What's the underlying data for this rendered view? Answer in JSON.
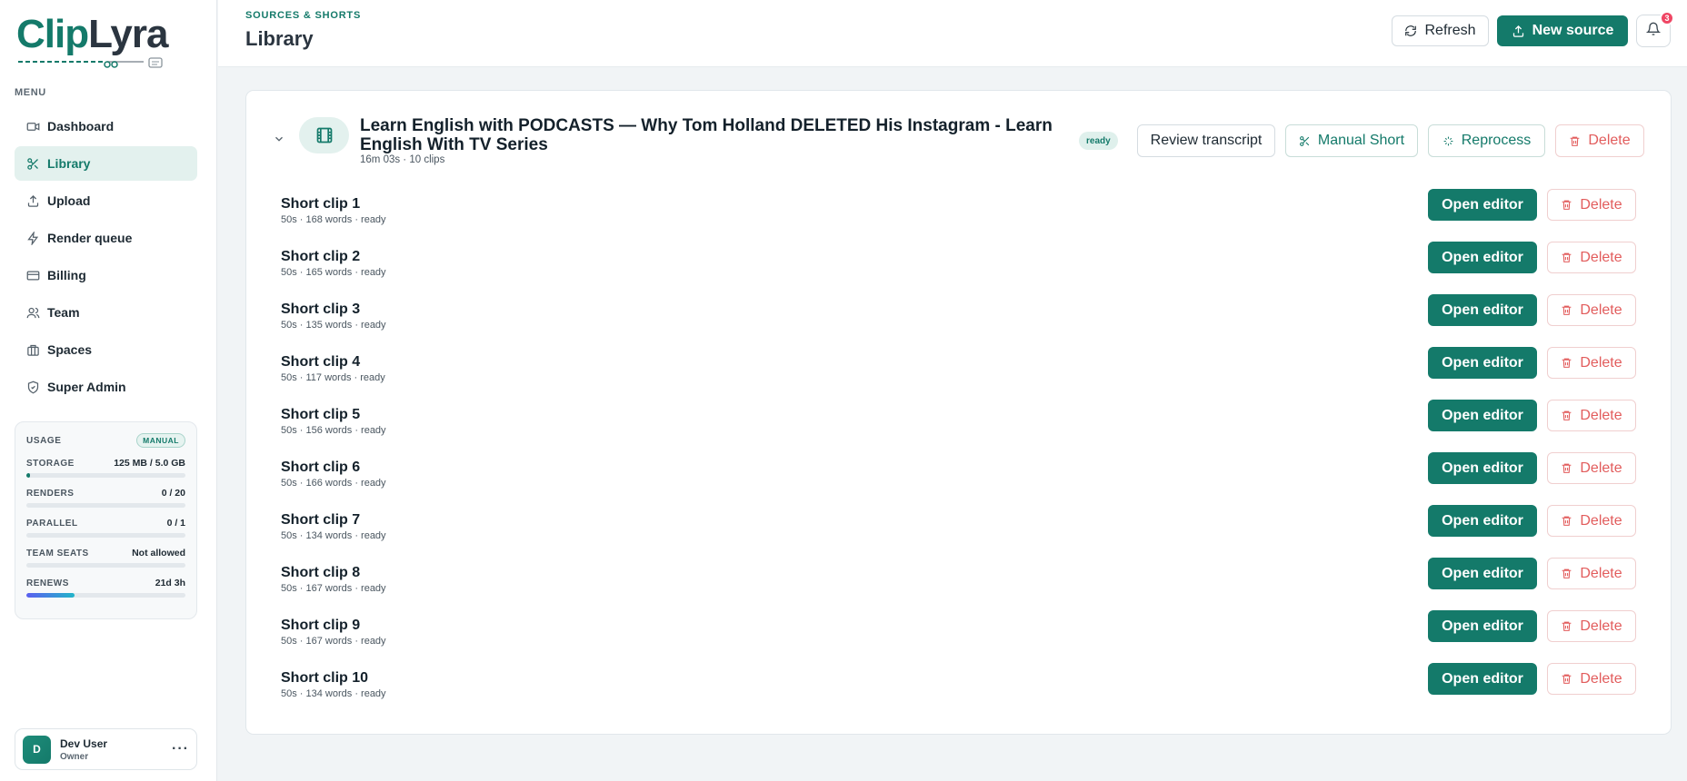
{
  "brand": {
    "logo_clip": "Clip",
    "logo_lyra": "Lyra",
    "accent": "#147a6a"
  },
  "sidebar": {
    "menu_title": "MENU",
    "items": [
      {
        "label": "Dashboard",
        "icon": "video-icon",
        "active": false
      },
      {
        "label": "Library",
        "icon": "scissors-icon",
        "active": true
      },
      {
        "label": "Upload",
        "icon": "upload-icon",
        "active": false
      },
      {
        "label": "Render queue",
        "icon": "bolt-icon",
        "active": false
      },
      {
        "label": "Billing",
        "icon": "card-icon",
        "active": false
      },
      {
        "label": "Team",
        "icon": "users-icon",
        "active": false
      },
      {
        "label": "Spaces",
        "icon": "briefcase-icon",
        "active": false
      },
      {
        "label": "Super Admin",
        "icon": "shield-icon",
        "active": false
      }
    ],
    "usage": {
      "title": "USAGE",
      "badge": "MANUAL",
      "meters": [
        {
          "label": "STORAGE",
          "value": "125 MB / 5.0 GB",
          "fraction": 0.024
        },
        {
          "label": "RENDERS",
          "value": "0 / 20",
          "fraction": 0
        },
        {
          "label": "PARALLEL",
          "value": "0 / 1",
          "fraction": 0
        },
        {
          "label": "TEAM SEATS",
          "value": "Not allowed",
          "fraction": 0
        },
        {
          "label": "RENEWS",
          "value": "21d 3h",
          "fraction": 0.3
        }
      ]
    },
    "user": {
      "initial": "D",
      "name": "Dev User",
      "role": "Owner",
      "more": "···"
    }
  },
  "header": {
    "eyebrow": "SOURCES & SHORTS",
    "title": "Library",
    "refresh_label": "Refresh",
    "new_source_label": "New source",
    "notification_count": "3"
  },
  "source": {
    "title": "Learn English with PODCASTS — Why Tom Holland DELETED His Instagram - Learn English With TV Series",
    "meta": "16m 03s · 10 clips",
    "status": "ready",
    "review_label": "Review transcript",
    "manual_label": "Manual Short",
    "reprocess_label": "Reprocess",
    "delete_label": "Delete"
  },
  "clips": [
    {
      "title": "Short clip 1",
      "meta": "50s · 168 words · ready"
    },
    {
      "title": "Short clip 2",
      "meta": "50s · 165 words · ready"
    },
    {
      "title": "Short clip 3",
      "meta": "50s · 135 words · ready"
    },
    {
      "title": "Short clip 4",
      "meta": "50s · 117 words · ready"
    },
    {
      "title": "Short clip 5",
      "meta": "50s · 156 words · ready"
    },
    {
      "title": "Short clip 6",
      "meta": "50s · 166 words · ready"
    },
    {
      "title": "Short clip 7",
      "meta": "50s · 134 words · ready"
    },
    {
      "title": "Short clip 8",
      "meta": "50s · 167 words · ready"
    },
    {
      "title": "Short clip 9",
      "meta": "50s · 167 words · ready"
    },
    {
      "title": "Short clip 10",
      "meta": "50s · 134 words · ready"
    }
  ],
  "clip_actions": {
    "open_label": "Open editor",
    "delete_label": "Delete"
  }
}
